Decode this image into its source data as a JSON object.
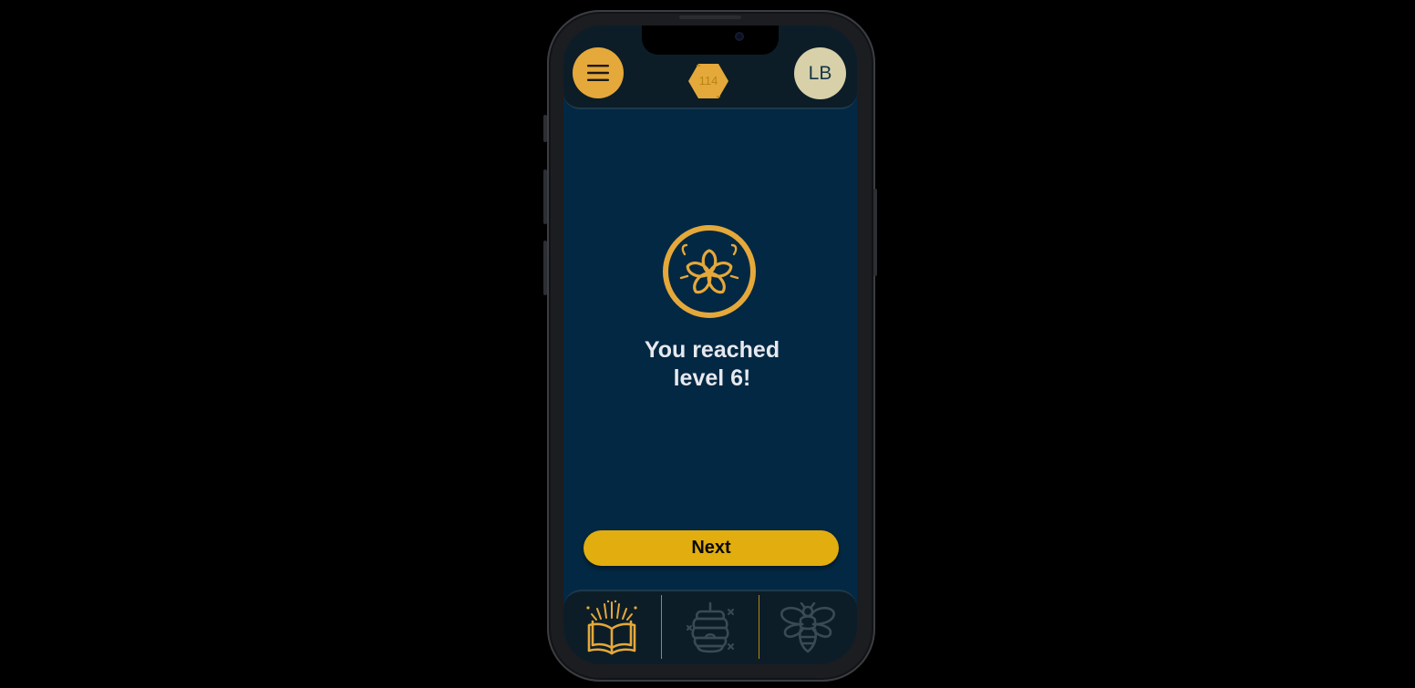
{
  "header": {
    "menu_icon": "hamburger-menu-icon",
    "hex_count": "114",
    "avatar_initials": "LB"
  },
  "main": {
    "icon": "flower-icon",
    "title_line1": "You reached",
    "title_line2": "level 6!",
    "next_label": "Next"
  },
  "bottom_nav": {
    "items": [
      {
        "icon": "open-book-sparkles-icon",
        "active": true
      },
      {
        "icon": "beehive-icon",
        "active": false
      },
      {
        "icon": "bee-icon",
        "active": false
      }
    ]
  },
  "colors": {
    "accent": "#e5a83a",
    "button": "#e2ad0f",
    "screen_bg": "#032843",
    "bar_bg": "#0c1d27",
    "inactive_icon": "#3a4a55",
    "avatar_bg": "#d8d0a8"
  }
}
